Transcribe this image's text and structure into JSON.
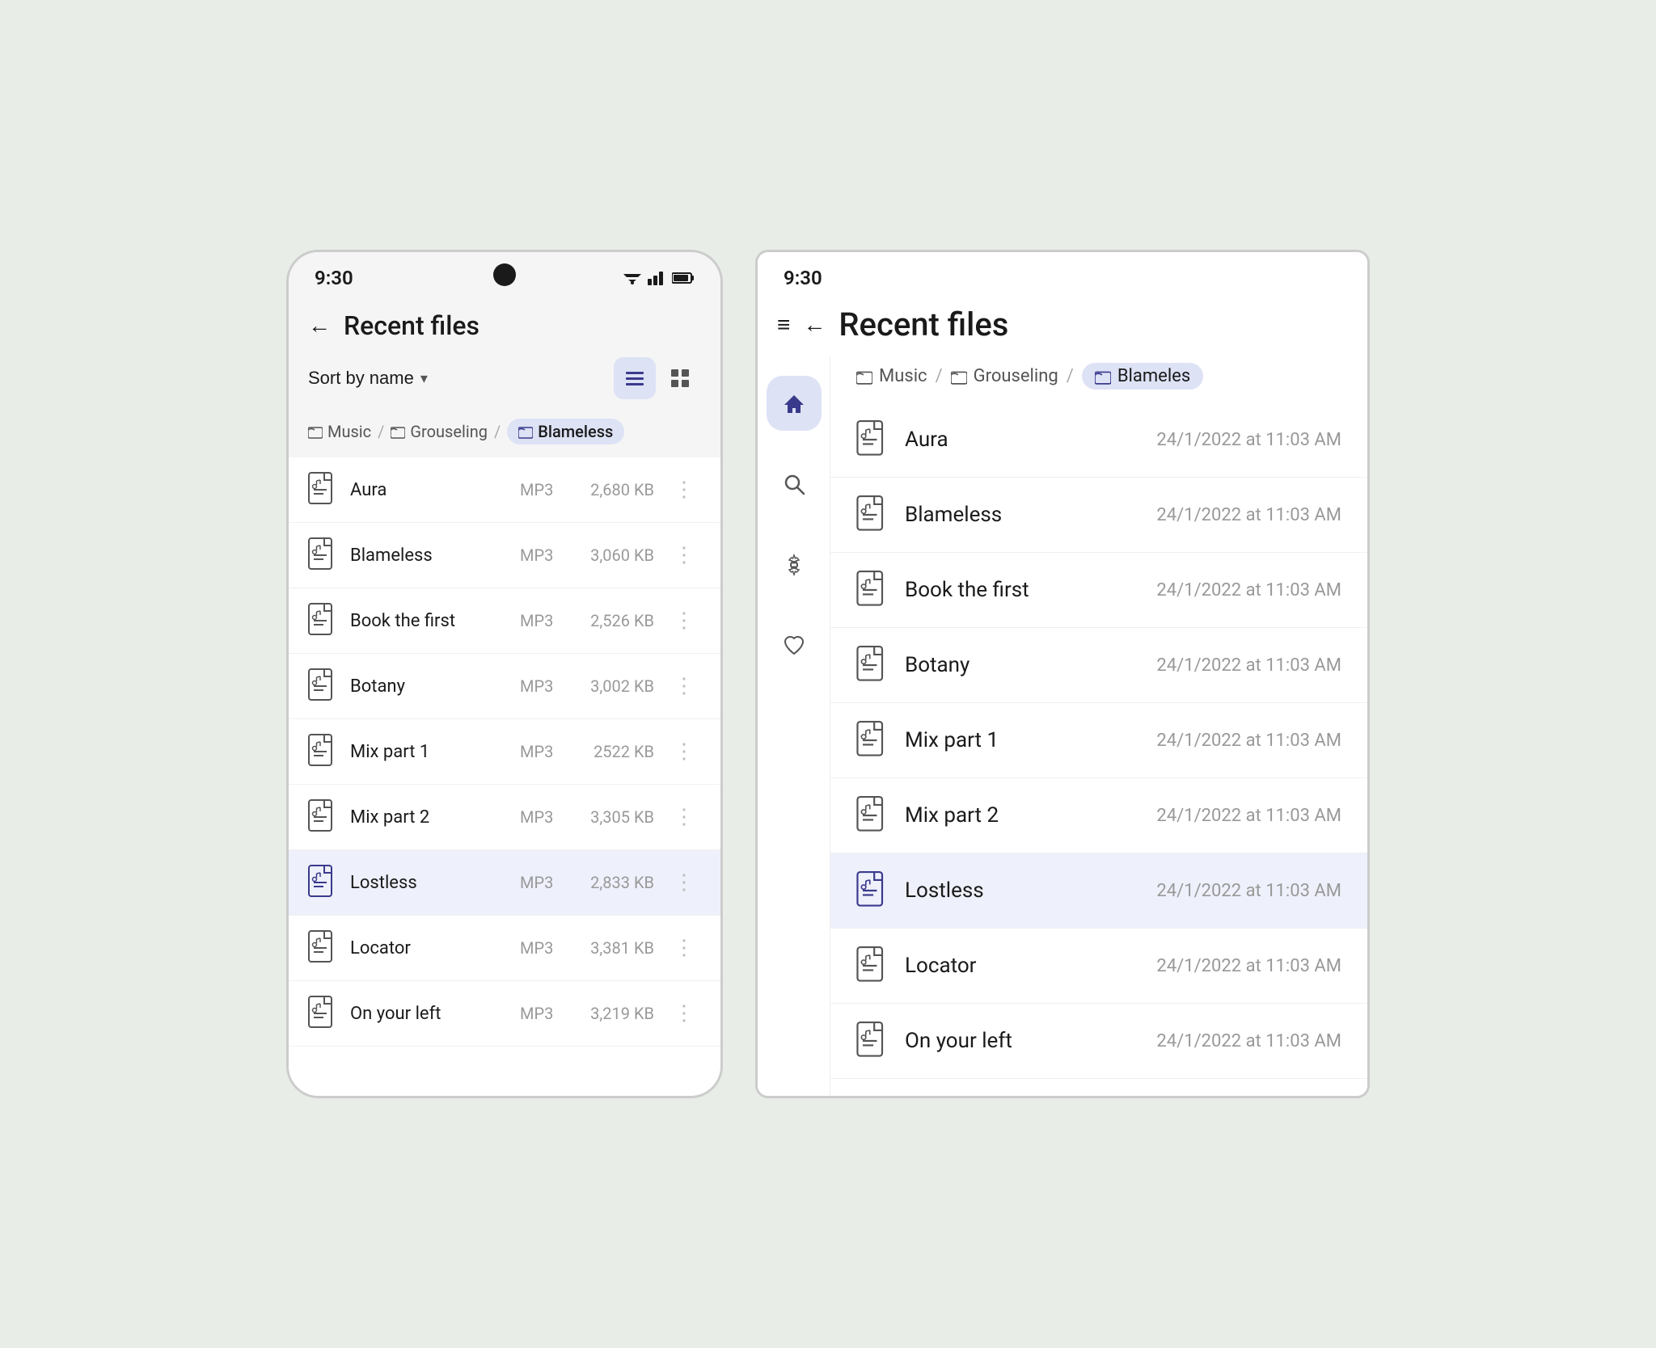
{
  "colors": {
    "bg": "#e8ede8",
    "active_bg": "#dde2f5",
    "selected_row": "#eef0fb",
    "text_primary": "#1a1a1a",
    "text_secondary": "#999",
    "accent": "#3a3a8c"
  },
  "phone": {
    "status_time": "9:30",
    "title": "Recent files",
    "back_label": "←",
    "sort_label": "Sort by name",
    "sort_chevron": "▾",
    "view_list_icon": "☰",
    "view_grid_icon": "⊞",
    "breadcrumb": [
      {
        "icon": "🗂",
        "label": "Music",
        "active": false
      },
      {
        "sep": "/"
      },
      {
        "icon": "🗂",
        "label": "Grouseling",
        "active": false
      },
      {
        "sep": "/"
      },
      {
        "icon": "🗂",
        "label": "Blameless",
        "active": true
      }
    ],
    "files": [
      {
        "name": "Aura",
        "type": "MP3",
        "size": "2,680 KB",
        "selected": false
      },
      {
        "name": "Blameless",
        "type": "MP3",
        "size": "3,060 KB",
        "selected": false
      },
      {
        "name": "Book the first",
        "type": "MP3",
        "size": "2,526 KB",
        "selected": false
      },
      {
        "name": "Botany",
        "type": "MP3",
        "size": "3,002 KB",
        "selected": false
      },
      {
        "name": "Mix part 1",
        "type": "MP3",
        "size": "2522 KB",
        "selected": false
      },
      {
        "name": "Mix part 2",
        "type": "MP3",
        "size": "3,305 KB",
        "selected": false
      },
      {
        "name": "Lostless",
        "type": "MP3",
        "size": "2,833 KB",
        "selected": true
      },
      {
        "name": "Locator",
        "type": "MP3",
        "size": "3,381 KB",
        "selected": false
      },
      {
        "name": "On your left",
        "type": "MP3",
        "size": "3,219 KB",
        "selected": false
      }
    ]
  },
  "tablet": {
    "status_time": "9:30",
    "title": "Recent files",
    "menu_icon": "≡",
    "back_label": "←",
    "breadcrumb": [
      {
        "icon": "🗂",
        "label": "Music",
        "active": false
      },
      {
        "sep": "/"
      },
      {
        "icon": "🗂",
        "label": "Grouseling",
        "active": false
      },
      {
        "sep": "/"
      },
      {
        "icon": "🗂",
        "label": "Blameles",
        "active": true
      }
    ],
    "nav_items": [
      {
        "icon": "⌂",
        "label": "Home",
        "active": true
      },
      {
        "icon": "🔍",
        "label": "Search",
        "active": false
      },
      {
        "icon": "⚙",
        "label": "Settings",
        "active": false
      },
      {
        "icon": "♡",
        "label": "Favorites",
        "active": false
      }
    ],
    "files": [
      {
        "name": "Aura",
        "date": "24/1/2022 at 11:03 AM",
        "selected": false
      },
      {
        "name": "Blameless",
        "date": "24/1/2022 at 11:03 AM",
        "selected": false
      },
      {
        "name": "Book the first",
        "date": "24/1/2022 at 11:03 AM",
        "selected": false
      },
      {
        "name": "Botany",
        "date": "24/1/2022 at 11:03 AM",
        "selected": false
      },
      {
        "name": "Mix part 1",
        "date": "24/1/2022 at 11:03 AM",
        "selected": false
      },
      {
        "name": "Mix part 2",
        "date": "24/1/2022 at 11:03 AM",
        "selected": false
      },
      {
        "name": "Lostless",
        "date": "24/1/2022 at 11:03 AM",
        "selected": true
      },
      {
        "name": "Locator",
        "date": "24/1/2022 at 11:03 AM",
        "selected": false
      },
      {
        "name": "On your left",
        "date": "24/1/2022 at 11:03 AM",
        "selected": false
      }
    ]
  }
}
